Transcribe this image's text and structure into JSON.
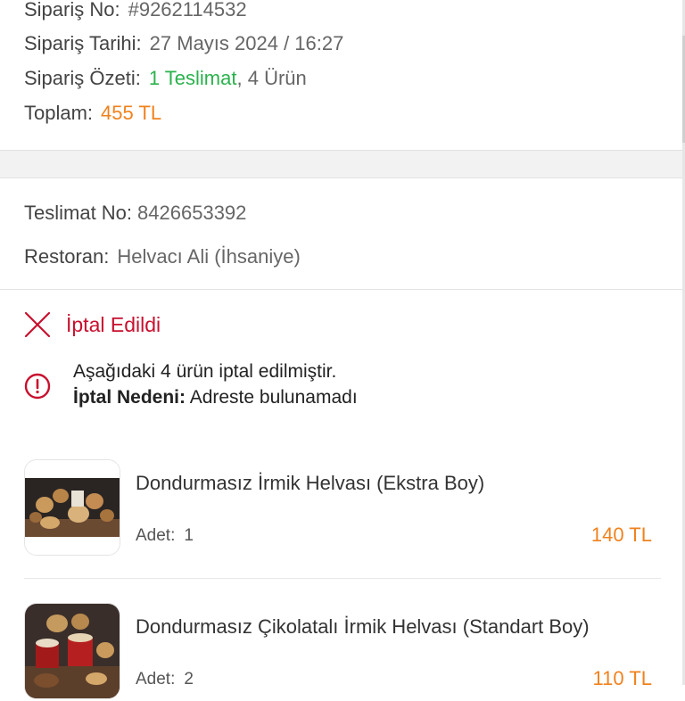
{
  "order": {
    "no_label": "Sipariş No:",
    "no_value": "#9262114532",
    "date_label": "Sipariş Tarihi:",
    "date_value": "27 Mayıs 2024 / 16:27",
    "summary_label": "Sipariş Özeti:",
    "summary_delivery": "1 Teslimat",
    "summary_sep": ",",
    "summary_items": "4 Ürün",
    "total_label": "Toplam:",
    "total_value": "455 TL"
  },
  "delivery": {
    "no_label": "Teslimat No:",
    "no_value": "8426653392",
    "restaurant_label": "Restoran:",
    "restaurant_value": "Helvacı Ali (İhsaniye)"
  },
  "status": {
    "label": "İptal Edildi",
    "icon": "close-x-icon",
    "color": "#c8102e"
  },
  "notice": {
    "line1": "Aşağıdaki 4 ürün iptal edilmiştir.",
    "reason_label": "İptal Nedeni:",
    "reason_value": "Adreste bulunamadı",
    "icon": "info-circle-icon"
  },
  "items": [
    {
      "name": "Dondurmasız İrmik Helvası (Ekstra Boy)",
      "qty_label": "Adet:",
      "qty": "1",
      "price": "140 TL"
    },
    {
      "name": "Dondurmasız Çikolatalı İrmik Helvası (Standart Boy)",
      "qty_label": "Adet:",
      "qty": "2",
      "price": "110 TL"
    }
  ],
  "colors": {
    "accent_green": "#2bb24c",
    "accent_orange": "#f0821e",
    "cancel_red": "#c8102e"
  }
}
